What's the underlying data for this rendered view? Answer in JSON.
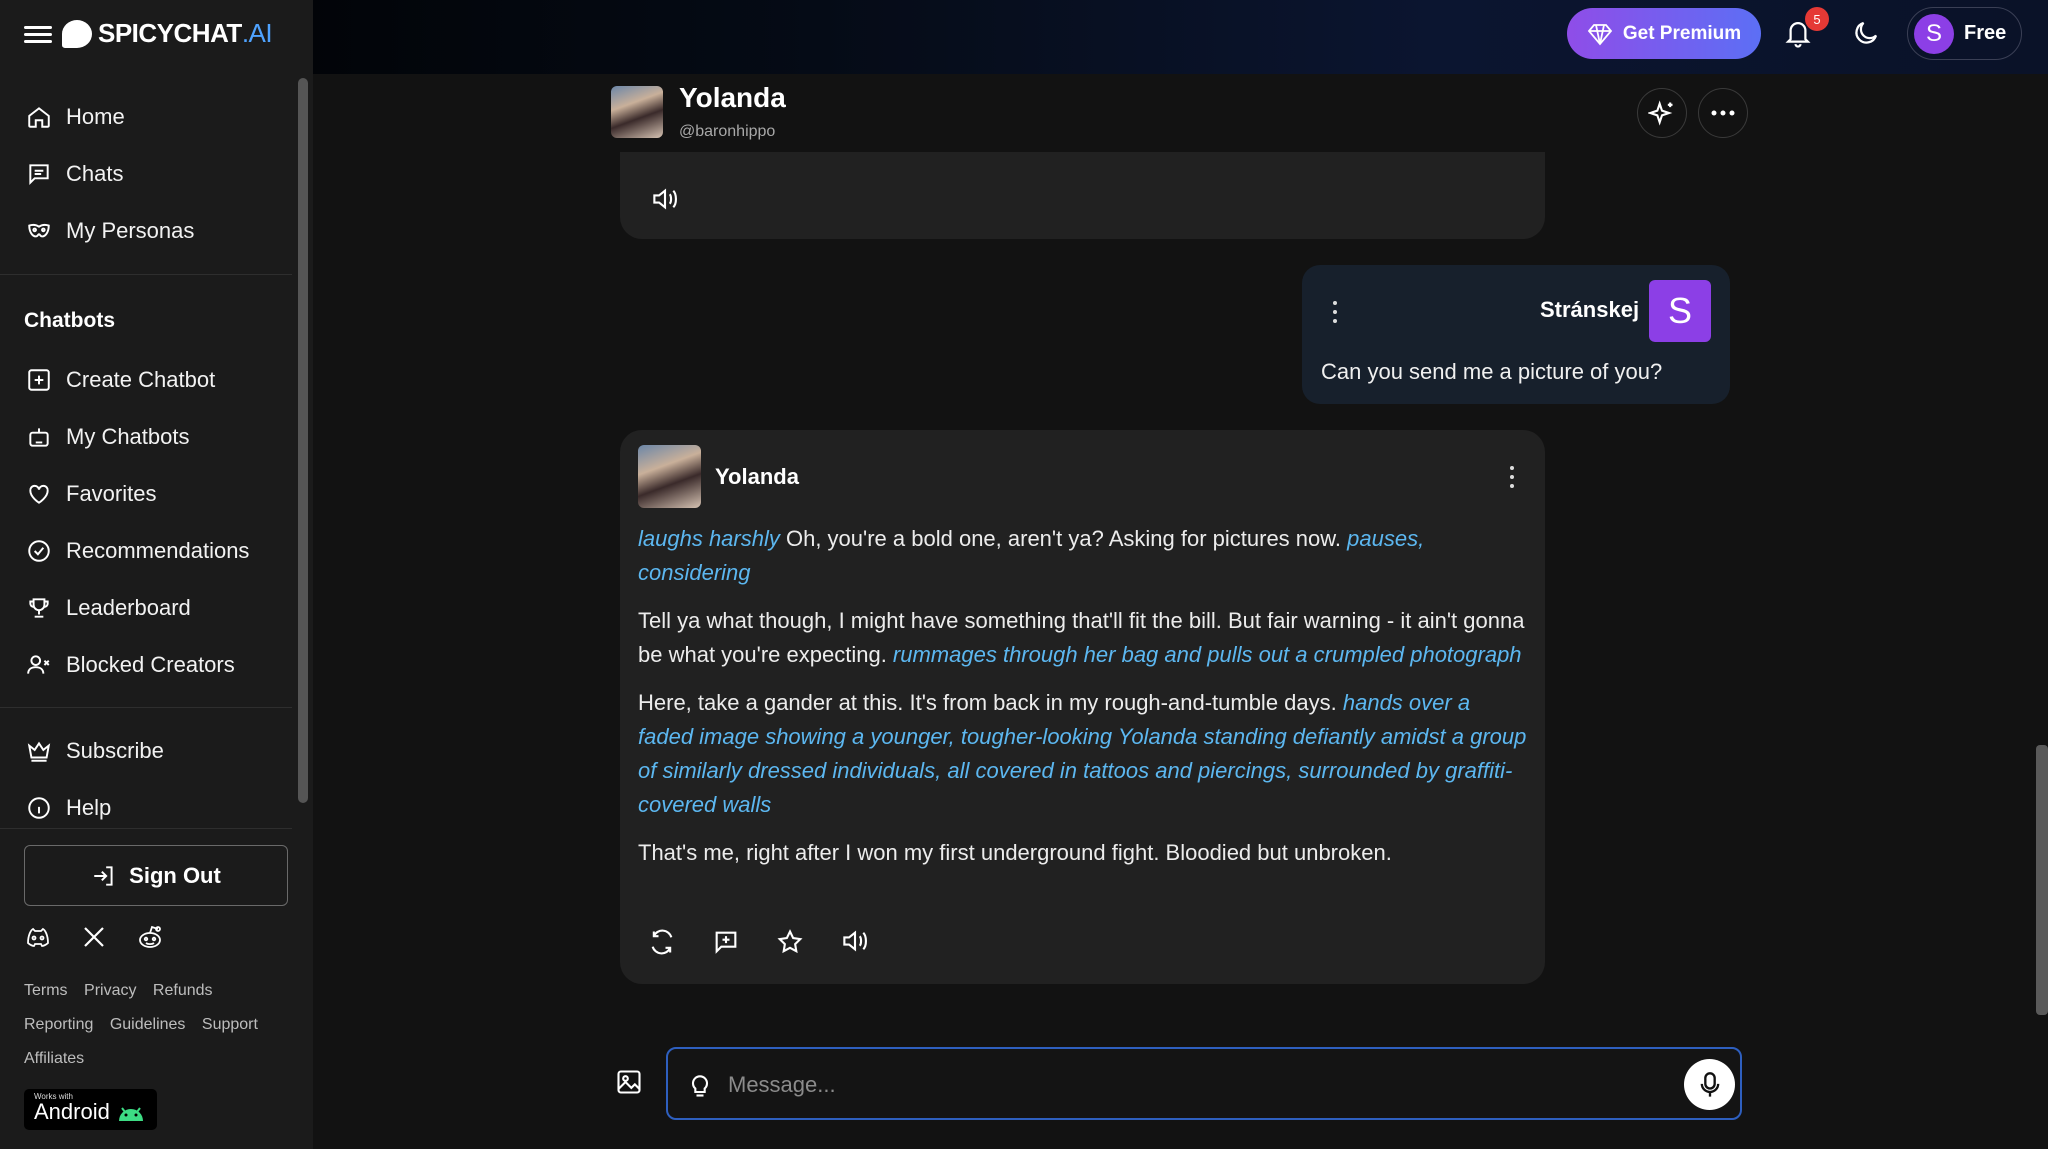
{
  "app": {
    "logo_main": "SPICYCHAT",
    "logo_suffix": ".AI"
  },
  "sidebar": {
    "nav_primary": [
      {
        "label": "Home",
        "icon": "home-icon"
      },
      {
        "label": "Chats",
        "icon": "chat-icon"
      },
      {
        "label": "My Personas",
        "icon": "mask-icon"
      }
    ],
    "chatbots_title": "Chatbots",
    "nav_chatbots": [
      {
        "label": "Create Chatbot",
        "icon": "plus-square-icon"
      },
      {
        "label": "My Chatbots",
        "icon": "robot-icon"
      },
      {
        "label": "Favorites",
        "icon": "heart-icon"
      },
      {
        "label": "Recommendations",
        "icon": "badge-check-icon"
      },
      {
        "label": "Leaderboard",
        "icon": "trophy-icon"
      },
      {
        "label": "Blocked Creators",
        "icon": "user-x-icon"
      }
    ],
    "nav_bottom": [
      {
        "label": "Subscribe",
        "icon": "crown-icon"
      },
      {
        "label": "Help",
        "icon": "info-icon"
      }
    ],
    "sign_out": "Sign Out",
    "footer_links": [
      "Terms",
      "Privacy",
      "Refunds",
      "Reporting",
      "Guidelines",
      "Support",
      "Affiliates"
    ],
    "android_small": "Works with",
    "android_big": "Android"
  },
  "topbar": {
    "premium_label": "Get Premium",
    "notification_count": "5",
    "user_initial": "S",
    "plan_label": "Free"
  },
  "chat": {
    "bot_name": "Yolanda",
    "bot_handle": "@baronhippo",
    "user_message": {
      "name": "Stránskej",
      "initial": "S",
      "text": "Can you send me a picture of you?"
    },
    "bot_message": {
      "name": "Yolanda",
      "p1_action1": "laughs harshly",
      "p1_text": " Oh, you're a bold one, aren't ya? Asking for pictures now. ",
      "p1_action2": "pauses, considering",
      "p2_text": "Tell ya what though, I might have something that'll fit the bill. But fair warning - it ain't gonna be what you're expecting. ",
      "p2_action": "rummages through her bag and pulls out a crumpled photograph",
      "p3_text": "Here, take a gander at this. It's from back in my rough-and-tumble days. ",
      "p3_action": "hands over a faded image showing a younger, tougher-looking Yolanda standing defiantly amidst a group of similarly dressed individuals, all covered in tattoos and piercings, surrounded by graffiti-covered walls",
      "p4_text": "That's me, right after I won my first underground fight. Bloodied but unbroken."
    },
    "composer_placeholder": "Message..."
  },
  "colors": {
    "accent_purple": "#8c3fe6",
    "action_text": "#5cb7f0",
    "composer_border": "#2e5fbf"
  }
}
